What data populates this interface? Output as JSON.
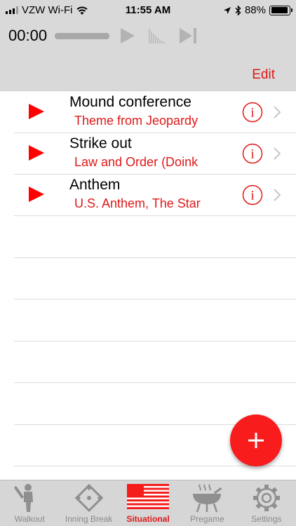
{
  "status_bar": {
    "carrier": "VZW Wi-Fi",
    "time": "11:55 AM",
    "battery": "88%",
    "battery_level": 0.88
  },
  "player": {
    "elapsed": "00:00",
    "edit_label": "Edit"
  },
  "rows": [
    {
      "title": "Mound conference",
      "song": "Theme from Jeopardy"
    },
    {
      "title": "Strike out",
      "song": "Law and Order (Doink"
    },
    {
      "title": "Anthem",
      "song": "U.S. Anthem, The Star"
    }
  ],
  "tabs": [
    {
      "label": "Walkout",
      "icon": "batter-icon",
      "active": false
    },
    {
      "label": "Inning Break",
      "icon": "diamond-icon",
      "active": false
    },
    {
      "label": "Situational",
      "icon": "flag-icon",
      "active": true
    },
    {
      "label": "Pregame",
      "icon": "grill-icon",
      "active": false
    },
    {
      "label": "Settings",
      "icon": "gear-icon",
      "active": false
    }
  ],
  "colors": {
    "accent": "#e01818",
    "header_bg": "#d9d9d9",
    "fab": "#f81c1c"
  }
}
